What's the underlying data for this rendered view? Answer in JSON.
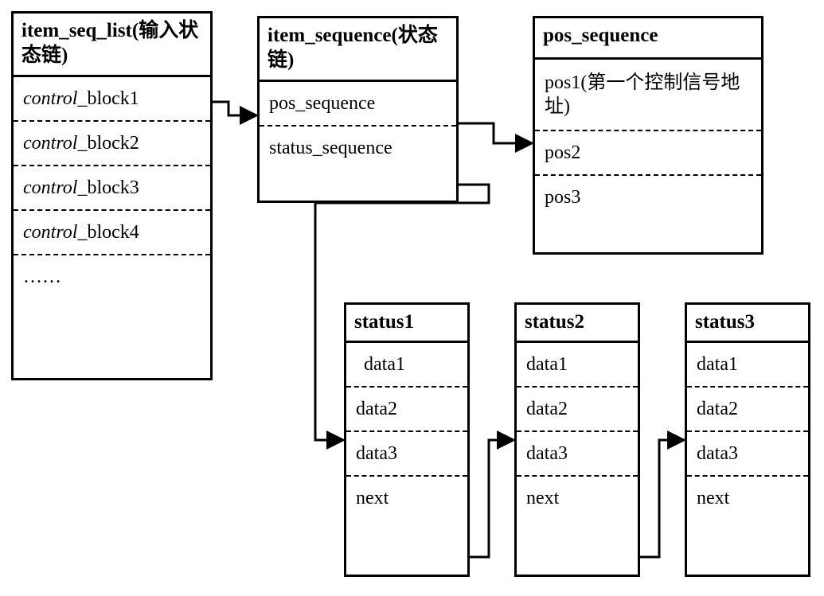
{
  "boxes": {
    "item_seq_list": {
      "title": "item_seq_list(输入状态链)",
      "rows": [
        {
          "prefix": "control",
          "suffix": "_block1"
        },
        {
          "prefix": "control",
          "suffix": "_block2"
        },
        {
          "prefix": "control",
          "suffix": "_block3"
        },
        {
          "prefix": "control",
          "suffix": "_block4"
        },
        {
          "prefix": "",
          "suffix": "……"
        }
      ]
    },
    "item_sequence": {
      "title": "item_sequence(状态链)",
      "rows": [
        {
          "label": "pos_sequence"
        },
        {
          "label": "status_sequence"
        }
      ]
    },
    "pos_sequence": {
      "title": "pos_sequence",
      "rows": [
        {
          "label": "pos1(第一个控制信号地址)"
        },
        {
          "label": "pos2"
        },
        {
          "label": "pos3"
        }
      ]
    },
    "status1": {
      "title": "status1",
      "rows": [
        {
          "label": "data1",
          "indent": true
        },
        {
          "label": "data2"
        },
        {
          "label": "data3"
        },
        {
          "label": "next"
        }
      ]
    },
    "status2": {
      "title": "status2",
      "rows": [
        {
          "label": "data1"
        },
        {
          "label": "data2"
        },
        {
          "label": "data3"
        },
        {
          "label": "next"
        }
      ]
    },
    "status3": {
      "title": "status3",
      "rows": [
        {
          "label": "data1"
        },
        {
          "label": "data2"
        },
        {
          "label": "data3"
        },
        {
          "label": "next"
        }
      ]
    }
  }
}
